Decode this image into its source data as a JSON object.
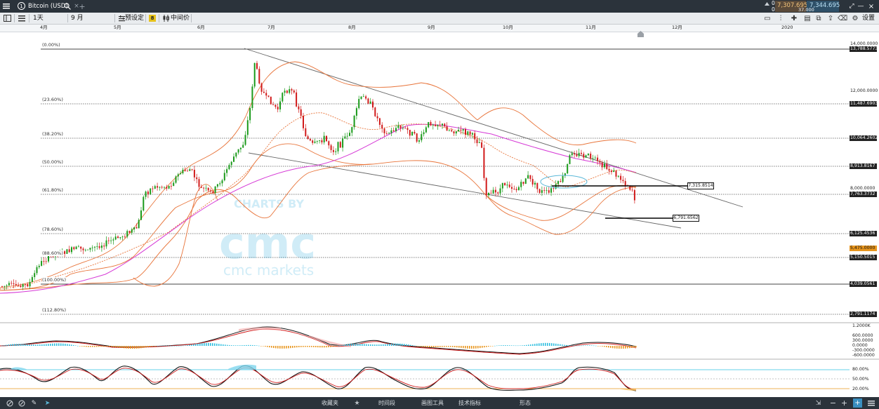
{
  "title_bar": {
    "instrument_number": "1",
    "instrument_name": "Bitcoin (USD)",
    "change_pct": "0%",
    "change_points": "0点",
    "sell_price": "7,307.695",
    "buy_price": "7,344.695",
    "spread": "37.000",
    "settings_label": "设置"
  },
  "toolbar": {
    "timeframe": "1天",
    "month_field": "9 月",
    "preset_label": "预设定",
    "badge": "8",
    "price_type": "中间价"
  },
  "months": [
    "4月",
    "5月",
    "6月",
    "7月",
    "8月",
    "9月",
    "10月",
    "11月",
    "12月",
    "2020"
  ],
  "fibonacci": [
    {
      "label": "(0.00%)",
      "price": "13,788.5773"
    },
    {
      "label": "(23.60%)",
      "price": "11,487.6903"
    },
    {
      "label": "(38.20%)",
      "price": "10,064.2602"
    },
    {
      "label": "(50.00%)",
      "price": "8,913.8167"
    },
    {
      "label": "(61.80%)",
      "price": "7,763.3732"
    },
    {
      "label": "(78.60%)",
      "price": "6,125.4536"
    },
    {
      "label": "(88.60%)",
      "price": "5,150.5015"
    },
    {
      "label": "(100.00%)",
      "price": "4,039.0561"
    },
    {
      "label": "(112.80%)",
      "price": "2,791.1174"
    }
  ],
  "price_axis": {
    "ticks": [
      "14,000.0000",
      "12,000.0000",
      "8,000.0000",
      "5,475.0000"
    ],
    "current_price": "5,475.0000",
    "support_1": "7,315.8514",
    "support_2": "6,791.6562"
  },
  "watermark": {
    "top": "CHARTS BY",
    "logo": "cmc",
    "bottom": "cmc markets"
  },
  "macd_axis": [
    "1.2000K",
    "600.0000",
    "300.0000",
    "0.0000",
    "-300.0000",
    "-600.0000"
  ],
  "stoch_axis": [
    "80.00%",
    "50.00%",
    "20.00%"
  ],
  "bottom_bar": {
    "tabs": [
      "收藏夹",
      "时间段",
      "画图工具",
      "技术指标",
      "形态"
    ]
  },
  "colors": {
    "up": "#1a9a1a",
    "down": "#d11a1a",
    "bollinger": "#e8743a",
    "ma": "#d63ad6",
    "channel": "#555555",
    "accent_orange": "#e8961e",
    "dark_bar": "#2b333b"
  }
}
